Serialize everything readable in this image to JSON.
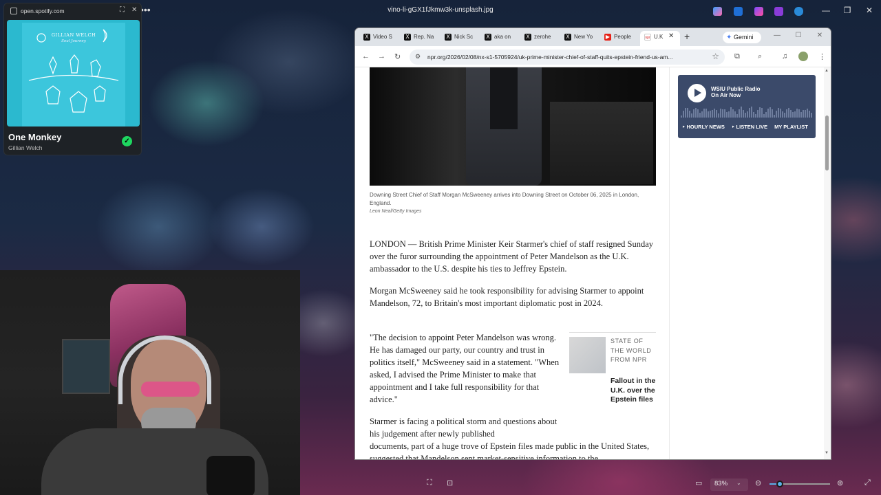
{
  "viewer": {
    "title": "vino-li-gGX1fJkmw3k-unsplash.jpg",
    "more_label": "•••",
    "zoom": "83%",
    "zoom_fraction": 0.17,
    "window_controls": [
      "—",
      "❐",
      "✕"
    ]
  },
  "spotify": {
    "url": "open.spotify.com",
    "album_title": "GILLIAN WELCH",
    "album_subtitle": "Soul Journey",
    "track": "One Monkey",
    "artist": "Gillian Welch",
    "accent": "#1ed760"
  },
  "browser": {
    "tabs": [
      {
        "label": "Video S",
        "icon": "x-icon"
      },
      {
        "label": "Rep. Na",
        "icon": "x-icon"
      },
      {
        "label": "Nick Sc",
        "icon": "x-icon"
      },
      {
        "label": "aka on",
        "icon": "x-icon"
      },
      {
        "label": "zerohe",
        "icon": "x-icon"
      },
      {
        "label": "New Yo",
        "icon": "x-icon"
      },
      {
        "label": "People",
        "icon": "youtube-icon"
      },
      {
        "label": "U.K",
        "icon": "npr-icon"
      }
    ],
    "gemini_label": "Gemini",
    "url": "npr.org/2026/02/08/nx-s1-5705924/uk-prime-minister-chief-of-staff-quits-epstein-friend-us-am..."
  },
  "article": {
    "caption": "Downing Street Chief of Staff Morgan McSweeney arrives into Downing Street on October 06, 2025 in London, England.",
    "credit": "Leon Neal/Getty Images",
    "paragraphs": [
      "LONDON — British Prime Minister Keir Starmer's chief of staff resigned Sunday over the furor surrounding the appointment of Peter Mandelson as the U.K. ambassador to the U.S. despite his ties to Jeffrey Epstein.",
      "Morgan McSweeney said he took responsibility for advising Starmer to appoint Mandelson, 72, to Britain's most important diplomatic post in 2024.",
      "\"The decision to appoint Peter Mandelson was wrong. He has damaged our party, our country and trust in politics itself,\" McSweeney said in a statement. \"When asked, I advised the Prime Minister to make that appointment and I take full responsibility for that advice.\"",
      "Starmer is facing a political storm and questions about his judgement after newly published",
      "documents, part of a huge trove of Epstein files made public in the United States, suggested that Mandelson sent market-sensitive information to the"
    ],
    "related_kicker": "STATE OF THE WORLD FROM NPR",
    "related_title": "Fallout in the U.K. over the Epstein files"
  },
  "radio": {
    "station": "WSIU Public Radio",
    "status": "On Air Now",
    "links": [
      "‣ HOURLY NEWS",
      "‣ LISTEN LIVE",
      "MY PLAYLIST"
    ],
    "color": "#3b4a6a"
  }
}
